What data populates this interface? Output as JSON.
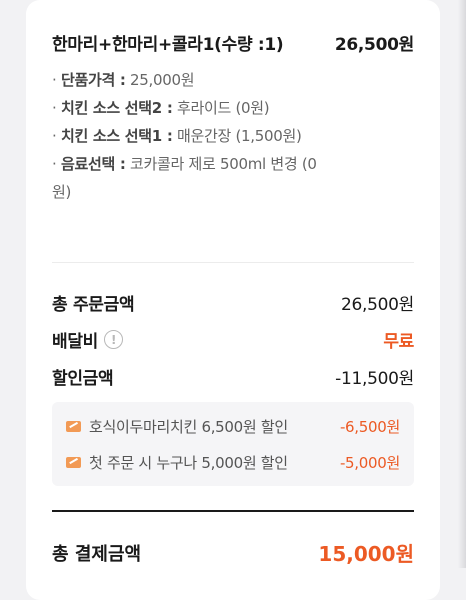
{
  "item": {
    "title": "한마리+한마리+콜라1(수량 :1)",
    "price": "26,500원",
    "options": [
      {
        "key": "단품가격 :",
        "value": "25,000원"
      },
      {
        "key": "치킨 소스 선택2 :",
        "value": "후라이드 (0원)"
      },
      {
        "key": "치킨 소스 선택1 :",
        "value": "매운간장 (1,500원)"
      },
      {
        "key": "음료선택 :",
        "value": "코카콜라 제로 500ml 변경 (0원)"
      }
    ]
  },
  "summary": {
    "order_total_label": "총 주문금액",
    "order_total_value": "26,500원",
    "delivery_label": "배달비",
    "delivery_value": "무료",
    "discount_label": "할인금액",
    "discount_value": "-11,500원"
  },
  "discounts": [
    {
      "name": "호식이두마리치킨 6,500원 할인",
      "amount": "-6,500원"
    },
    {
      "name": "첫 주문 시 누구나 5,000원 할인",
      "amount": "-5,000원"
    }
  ],
  "total": {
    "label": "총 결제금액",
    "value": "15,000원"
  },
  "colors": {
    "accent": "#ec5a24",
    "coupon": "#f29a55"
  },
  "icons": {
    "info": "info-circle-icon",
    "coupon": "coupon-icon"
  }
}
